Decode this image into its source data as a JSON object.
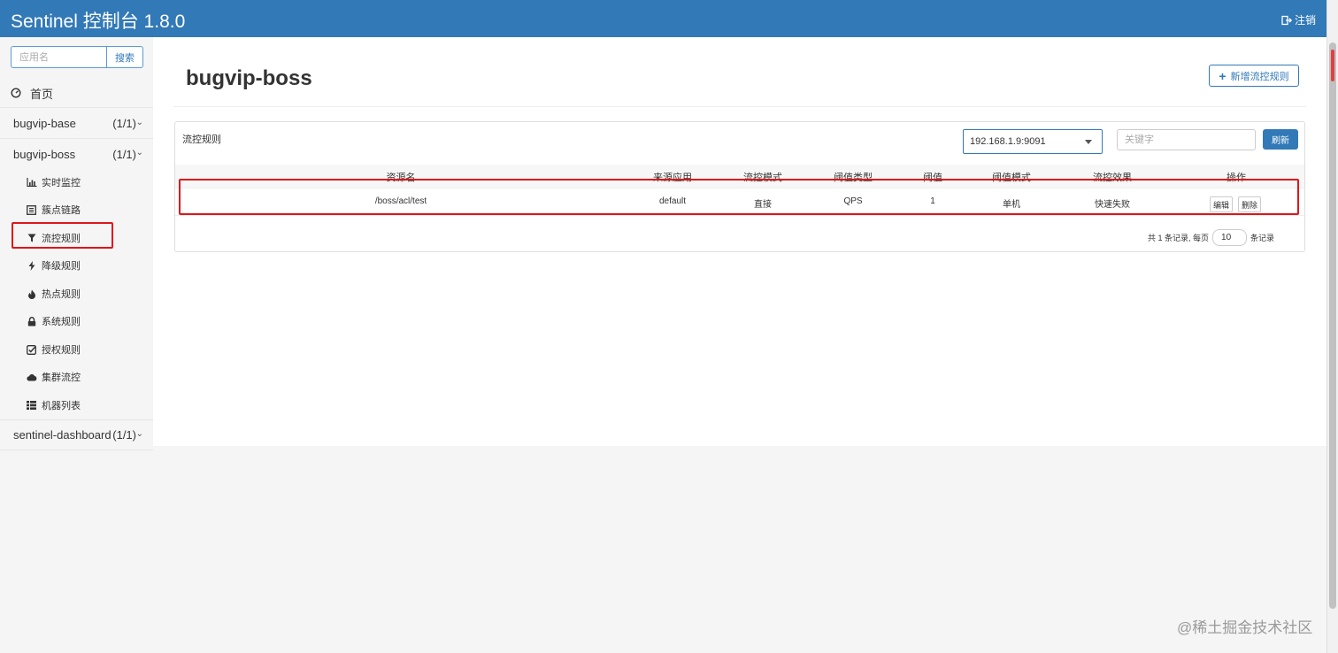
{
  "header": {
    "title": "Sentinel 控制台 1.8.0",
    "logout_label": "注销"
  },
  "sidebar": {
    "search_placeholder": "应用名",
    "search_button": "搜索",
    "home_label": "首页",
    "apps": [
      {
        "name": "bugvip-base",
        "count": "(1/1)"
      },
      {
        "name": "bugvip-boss",
        "count": "(1/1)"
      },
      {
        "name": "sentinel-dashboard",
        "count": "(1/1)"
      }
    ],
    "menu_items": [
      {
        "label": "实时监控",
        "icon": "bar-chart-icon"
      },
      {
        "label": "簇点链路",
        "icon": "list-icon"
      },
      {
        "label": "流控规则",
        "icon": "filter-icon"
      },
      {
        "label": "降级规则",
        "icon": "flash-icon"
      },
      {
        "label": "热点规则",
        "icon": "fire-icon"
      },
      {
        "label": "系统规则",
        "icon": "lock-icon"
      },
      {
        "label": "授权规则",
        "icon": "check-square-icon"
      },
      {
        "label": "集群流控",
        "icon": "cloud-icon"
      },
      {
        "label": "机器列表",
        "icon": "th-list-icon"
      }
    ],
    "active_item": "流控规则"
  },
  "main": {
    "page_title": "bugvip-boss",
    "add_button": "新增流控规则",
    "panel_title": "流控规则",
    "machine_selected": "192.168.1.9:9091",
    "keyword_placeholder": "关键字",
    "refresh_button": "刷新",
    "table": {
      "columns": [
        "资源名",
        "来源应用",
        "流控模式",
        "阈值类型",
        "阈值",
        "阈值模式",
        "流控效果",
        "操作"
      ],
      "rows": [
        {
          "resource": "/boss/acl/test",
          "origin": "default",
          "mode": "直接",
          "threshold_type": "QPS",
          "threshold": "1",
          "threshold_mode": "单机",
          "effect": "快速失败",
          "edit": "编辑",
          "delete": "删除"
        }
      ]
    },
    "pagination": {
      "prefix": "共 1 条记录, 每页",
      "page_size": "10",
      "suffix": "条记录"
    }
  },
  "watermark": "@稀土掘金技术社区",
  "colors": {
    "header_bg": "#3279b7",
    "accent": "#3279b7",
    "highlight": "#e0151a"
  }
}
